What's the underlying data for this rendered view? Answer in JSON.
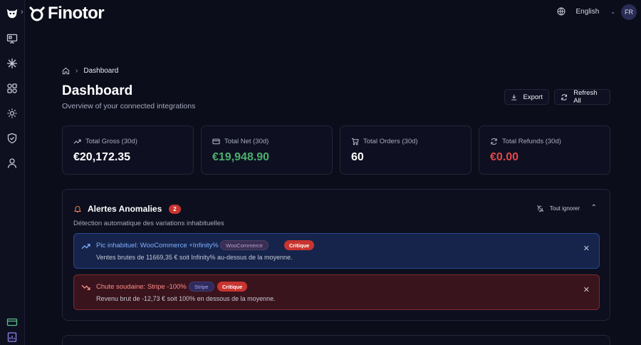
{
  "header": {
    "brand": "Finotor",
    "language": "English",
    "avatar_initials": "FR"
  },
  "breadcrumb": {
    "current": "Dashboard"
  },
  "page": {
    "title": "Dashboard",
    "subtitle": "Overview of your connected integrations"
  },
  "actions": {
    "export_label": "Export",
    "refresh_label": "Refresh All"
  },
  "stats": [
    {
      "label": "Total Gross (30d)",
      "value": "€20,172.35",
      "color": "#ffffff",
      "icon": "trend-up-icon"
    },
    {
      "label": "Total Net (30d)",
      "value": "€19,948.90",
      "color": "#4caf6e",
      "icon": "card-icon"
    },
    {
      "label": "Total Orders (30d)",
      "value": "60",
      "color": "#ffffff",
      "icon": "cart-icon"
    },
    {
      "label": "Total Refunds (30d)",
      "value": "€0.00",
      "color": "#e2474b",
      "icon": "refresh-icon"
    }
  ],
  "alerts_panel": {
    "title": "Alertes Anomalies",
    "count": "2",
    "subtitle": "Détection automatique des variations inhabituelles",
    "ignore_all": "Tout ignorer",
    "items": [
      {
        "title": "Pic inhabituel: WooCommerce +Infinity%",
        "source_tag": "WooCommerce",
        "severity": "Critique",
        "description": "Ventes brutes de 11669,35 € soit Infinity% au-dessus de la moyenne."
      },
      {
        "title": "Chute soudaine: Stripe -100%",
        "source_tag": "Stripe",
        "severity": "Critique",
        "description": "Revenu brut de -12,73 € soit 100% en dessous de la moyenne."
      }
    ]
  }
}
